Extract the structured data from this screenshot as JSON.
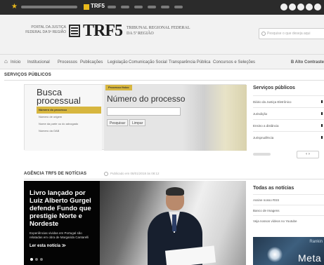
{
  "topbar": {
    "trf5": "TRF5",
    "controls": [
      "",
      "",
      "",
      "",
      ""
    ]
  },
  "header": {
    "portal": "PORTAL DA JUSTIÇA FEDERAL DA 5ª REGIÃO",
    "logo": "TRF5",
    "tribunal_line1": "TRIBUNAL REGIONAL FEDERAL",
    "tribunal_line2": "DA 5ª REGIÃO",
    "search_placeholder": "Pesquise o que deseja aqui"
  },
  "nav": {
    "items": [
      "Início",
      "Institucional",
      "Processos",
      "Publicações",
      "Legislação",
      "Comunicação Social",
      "Transparência Pública",
      "Concursos e Seleções"
    ],
    "accessibility": "B  Alto Contraste"
  },
  "servicos_publicos": {
    "section_title": "SERVIÇOS PÚBLICOS"
  },
  "busca": {
    "title_line1": "Busca",
    "title_line2": "processual",
    "links": [
      {
        "label": "Número do processo",
        "active": true
      },
      {
        "label": "Número de origem",
        "active": false
      },
      {
        "label": "Nome da parte ou do advogado",
        "active": false
      },
      {
        "label": "Número da OAB",
        "active": false
      }
    ],
    "form_tag": "Processo físico",
    "form_title": "Número do processo",
    "input_value": "",
    "btn_search": "Pesquisar",
    "btn_clear": "Limpar"
  },
  "servicos": {
    "title": "Serviços públicos",
    "items": [
      "Diário da Justiça Eletrônico",
      "Jurisdição",
      "Ensino a distância",
      "Jurisprudência"
    ],
    "count": "",
    "arrows": "‹   ›"
  },
  "agencia": {
    "section_title": "AGÊNCIA TRF5 DE NOTÍCIAS",
    "date": "Publicado em 08/01/2018 às 08:12"
  },
  "news": {
    "headline": "Livro lançado por Luiz Alberto Gurgel defende Fundo que prestigie Norte e Nordeste",
    "sub": "Experiências vividas em Portugal são relatadas em obra de Margarida Cantarelli",
    "more": "Ler esta notícia ≫",
    "slides": [
      {
        "active": true
      },
      {
        "active": false
      },
      {
        "active": false
      }
    ]
  },
  "todas": {
    "title": "Todas as notícias",
    "items": [
      "Assine nosso RSS",
      "Banco de Imagens",
      "Veja nossos vídeos no Youtube"
    ]
  },
  "banner": {
    "side_text": "",
    "rank": "Rankin",
    "meta": "Meta"
  },
  "icons": {
    "home": "home-icon",
    "star": "star-icon",
    "search": "search-icon"
  },
  "colors": {
    "accent": "#d7b63f",
    "topbar": "#2b2b2b",
    "header_bg": "#f2f2f2"
  }
}
